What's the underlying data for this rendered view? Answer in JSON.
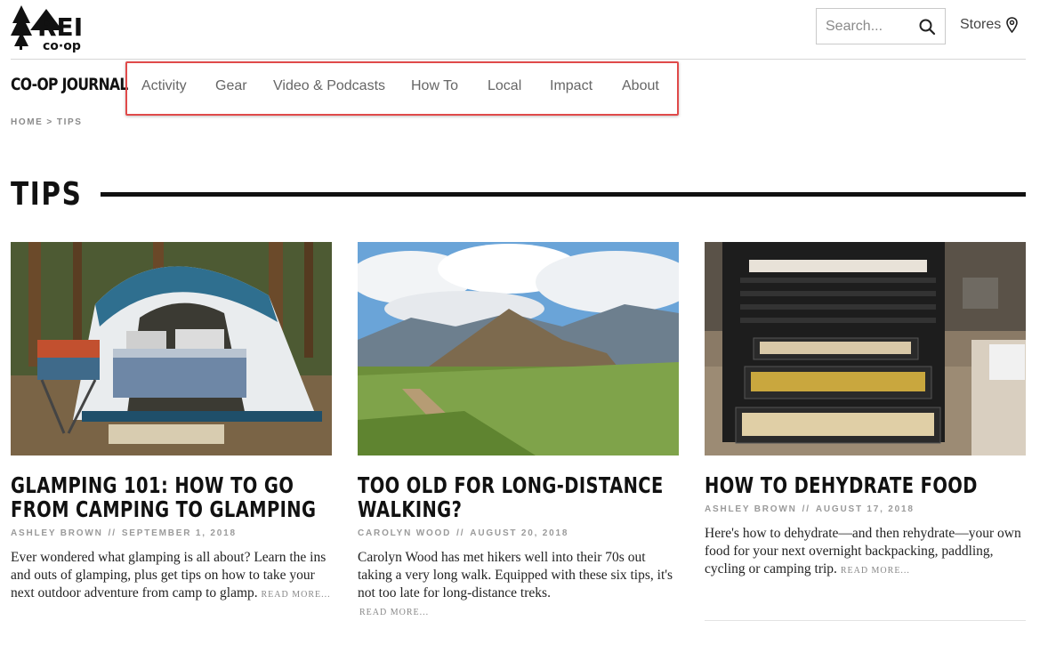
{
  "header": {
    "logo_text": "REI co-op",
    "search": {
      "placeholder": "Search...",
      "icon": "search-icon"
    },
    "stores": {
      "label": "Stores",
      "icon": "map-pin-icon"
    }
  },
  "journal": {
    "title": "CO-OP JOURNAL",
    "nav": [
      "Activity",
      "Gear",
      "Video & Podcasts",
      "How To",
      "Local",
      "Impact",
      "About"
    ]
  },
  "breadcrumb": {
    "home": "HOME",
    "separator": ">",
    "current": "TIPS"
  },
  "section": {
    "title": "TIPS"
  },
  "articles": [
    {
      "title": "Glamping 101: How to Go From Camping to Glamping",
      "author": "ASHLEY BROWN",
      "separator": "//",
      "date": "SEPTEMBER 1, 2018",
      "excerpt": "Ever wondered what glamping is all about? Learn the ins and outs of glamping, plus get tips on how to take your next outdoor adventure from camp to glamp.",
      "read_more": "READ MORE...",
      "image": "tent-photo"
    },
    {
      "title": "Too Old for Long-Distance Walking?",
      "author": "CAROLYN WOOD",
      "separator": "//",
      "date": "AUGUST 20, 2018",
      "excerpt": "Carolyn Wood has met hikers well into their 70s out taking a very long walk. Equipped with these six tips, it's not too late for long-distance treks.",
      "read_more": "READ MORE...",
      "image": "mountain-photo"
    },
    {
      "title": "How to Dehydrate Food",
      "author": "ASHLEY BROWN",
      "separator": "//",
      "date": "AUGUST 17, 2018",
      "excerpt": "Here's how to dehydrate—and then rehydrate—your own food for your next overnight backpacking, paddling, cycling or camping trip.",
      "read_more": "READ MORE...",
      "image": "dehydrator-photo"
    }
  ],
  "colors": {
    "accent_highlight": "#e04a4a",
    "text_dark": "#111111",
    "meta_gray": "#9a9a9a"
  }
}
